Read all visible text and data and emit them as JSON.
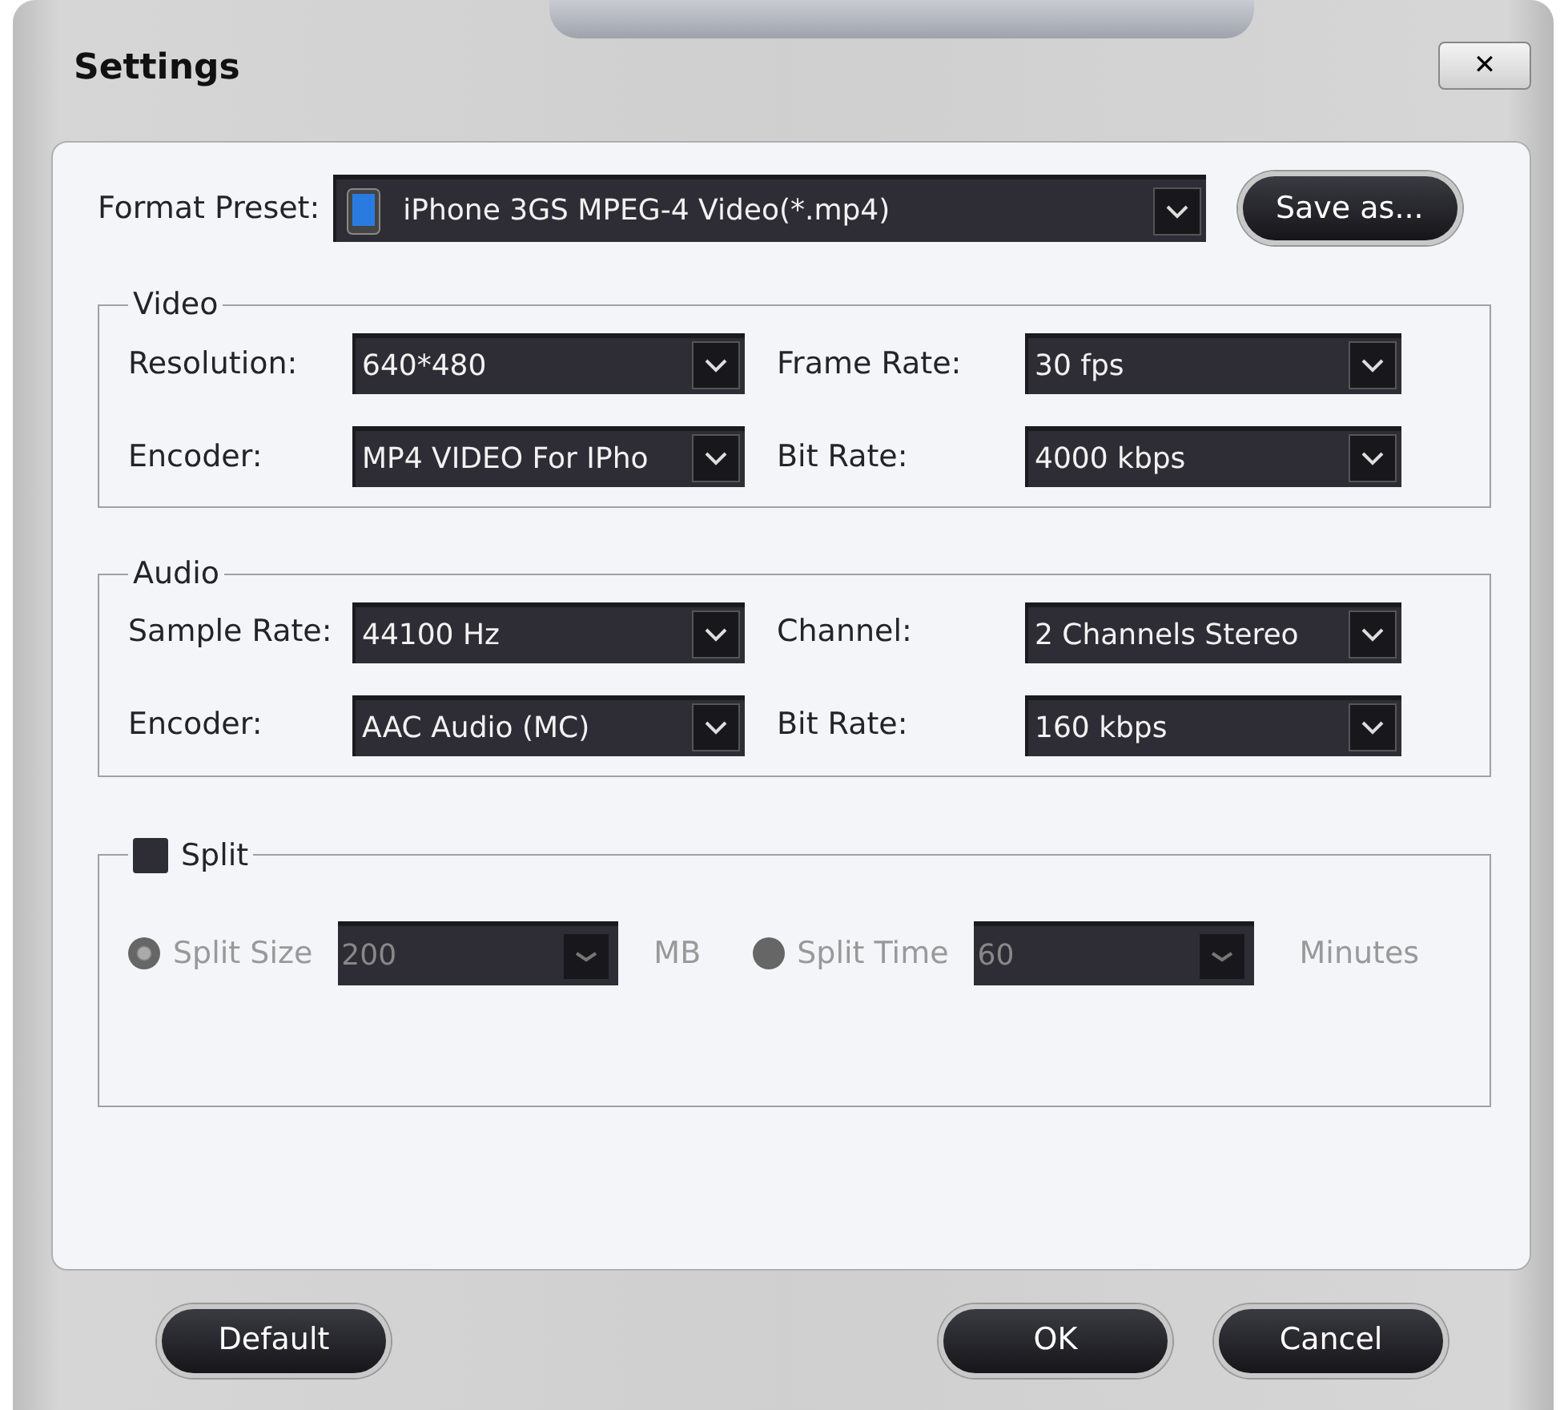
{
  "window": {
    "title": "Settings",
    "close": "✕"
  },
  "format_preset": {
    "label": "Format Preset:",
    "value": "iPhone 3GS MPEG-4 Video(*.mp4)",
    "save_button": "Save as..."
  },
  "video": {
    "title": "Video",
    "fields": [
      {
        "label": "Resolution:",
        "value": "640*480"
      },
      {
        "label": "Frame Rate:",
        "value": "30 fps"
      },
      {
        "label": "Encoder:",
        "value": "MP4 VIDEO For IPho"
      },
      {
        "label": "Bit Rate:",
        "value": "4000 kbps"
      }
    ]
  },
  "audio": {
    "title": "Audio",
    "fields": [
      {
        "label": "Sample Rate:",
        "value": "44100 Hz"
      },
      {
        "label": "Channel:",
        "value": "2 Channels Stereo"
      },
      {
        "label": "Encoder:",
        "value": "AAC Audio (MC)"
      },
      {
        "label": "Bit Rate:",
        "value": "160 kbps"
      }
    ]
  },
  "split": {
    "label": "Split",
    "checked": false,
    "disabled": true,
    "options": [
      {
        "label": "Split Size",
        "value": "200",
        "unit": "MB",
        "selected": true
      },
      {
        "label": "Split Time",
        "value": "60",
        "unit": "Minutes",
        "selected": false
      }
    ]
  },
  "buttons": [
    {
      "label": "Default",
      "kind": "left"
    },
    {
      "label": "OK",
      "kind": "right"
    },
    {
      "label": "Cancel",
      "kind": "right"
    }
  ]
}
